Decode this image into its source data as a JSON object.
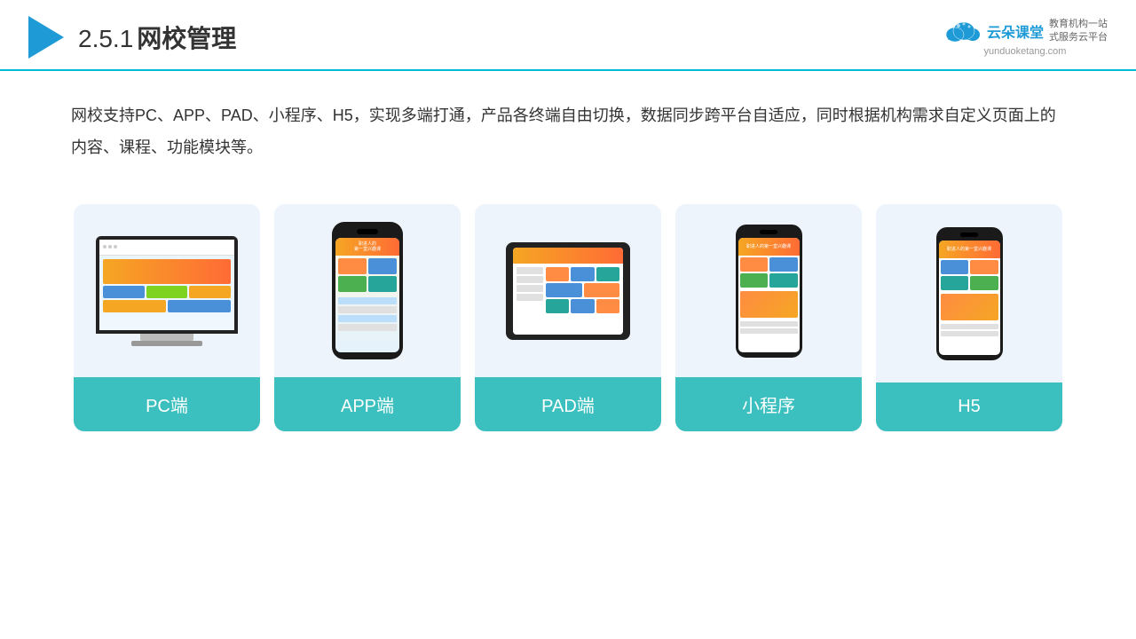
{
  "header": {
    "title": "2.5.1网校管理",
    "title_number": "2.5.1",
    "title_text": "网校管理"
  },
  "brand": {
    "name": "云朵课堂",
    "url": "yunduoketang.com",
    "tagline_line1": "教育机构一站",
    "tagline_line2": "式服务云平台"
  },
  "description": "网校支持PC、APP、PAD、小程序、H5，实现多端打通，产品各终端自由切换，数据同步跨平台自适应，同时根据机构需求自定义页面上的内容、课程、功能模块等。",
  "cards": [
    {
      "id": "pc",
      "label": "PC端",
      "type": "pc"
    },
    {
      "id": "app",
      "label": "APP端",
      "type": "phone"
    },
    {
      "id": "pad",
      "label": "PAD端",
      "type": "tablet"
    },
    {
      "id": "miniprogram",
      "label": "小程序",
      "type": "phone-small"
    },
    {
      "id": "h5",
      "label": "H5",
      "type": "phone-small"
    }
  ]
}
